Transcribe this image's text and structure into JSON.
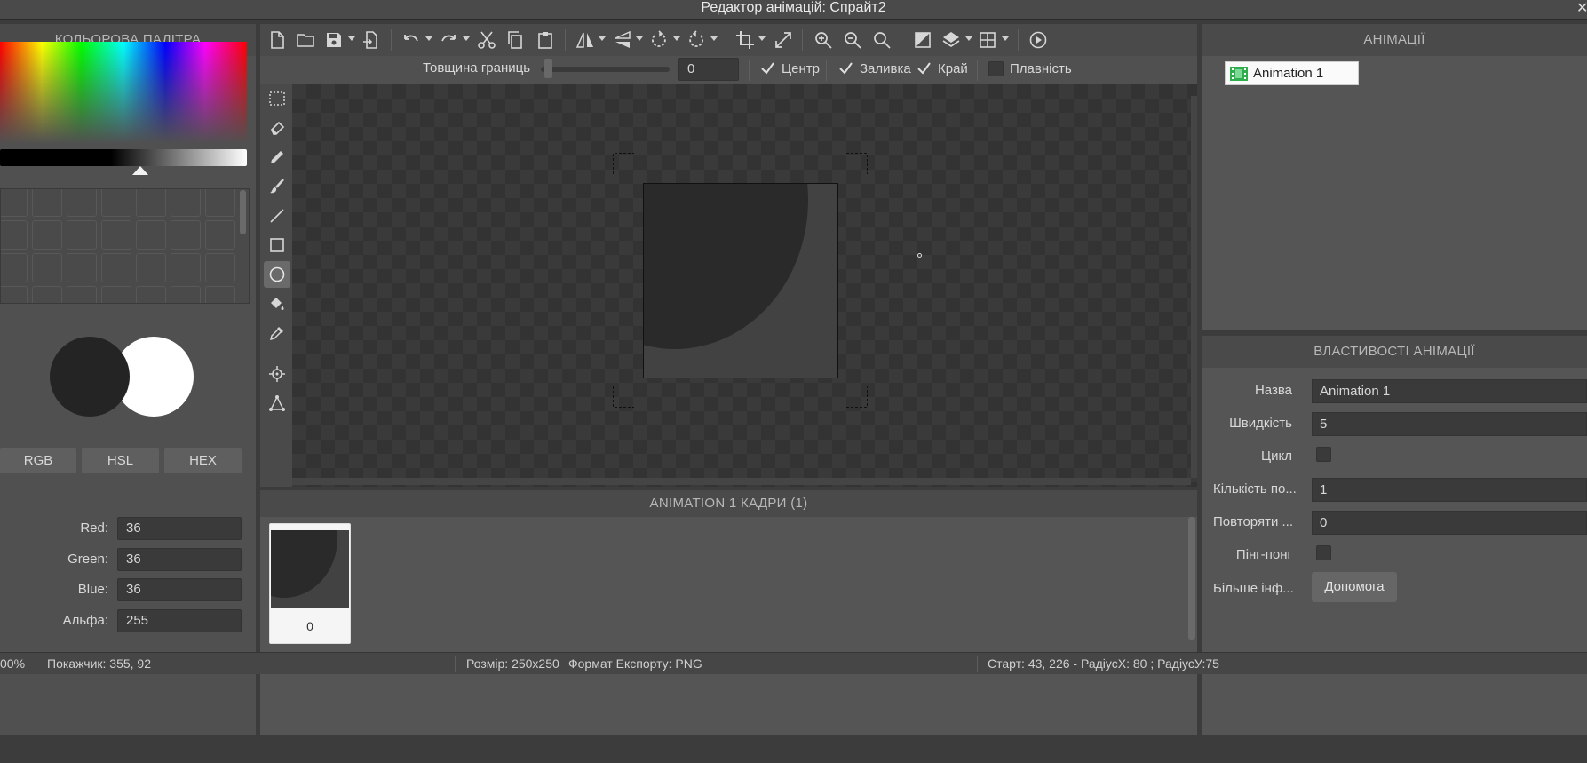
{
  "window": {
    "title": "Редактор анімацій: Спрайт2",
    "close_glyph": "✕"
  },
  "left_panel": {
    "header": "КОЛЬОРОВА ПАЛІТРА",
    "mode_buttons": [
      "RGB",
      "HSL",
      "HEX"
    ],
    "primary_color": "#242424",
    "secondary_color": "#ffffff",
    "fields": [
      {
        "label": "Red:",
        "value": "36"
      },
      {
        "label": "Green:",
        "value": "36"
      },
      {
        "label": "Blue:",
        "value": "36"
      },
      {
        "label": "Альфа:",
        "value": "255"
      }
    ]
  },
  "toolbar": {
    "icons": [
      "new-file-icon",
      "open-folder-icon",
      "save-icon",
      "export-icon",
      "undo-icon",
      "redo-icon",
      "cut-icon",
      "copy-icon",
      "paste-icon",
      "flip-horizontal-icon",
      "flip-vertical-icon",
      "rotate-left-icon",
      "rotate-right-icon",
      "crop-icon",
      "resize-icon",
      "zoom-in-icon",
      "zoom-out-icon",
      "zoom-reset-icon",
      "mask-icon",
      "layers-icon",
      "grid-icon",
      "play-icon"
    ]
  },
  "options": {
    "border_label": "Товщина границь",
    "border_value": "0",
    "center_label": "Центр",
    "fill_label": "Заливка",
    "edge_label": "Край",
    "smooth_label": "Плавність"
  },
  "frames_panel": {
    "header": "ANIMATION 1 КАДРИ (1)",
    "frames": [
      {
        "index": "0"
      }
    ]
  },
  "animations_panel": {
    "header": "АНІМАЦІЇ",
    "items": [
      {
        "label": "Animation 1"
      }
    ]
  },
  "properties": {
    "header": "ВЛАСТИВОСТІ АНІМАЦІЇ",
    "name_label": "Назва",
    "name_value": "Animation 1",
    "speed_label": "Швидкість",
    "speed_value": "5",
    "loop_label": "Цикл",
    "count_label": "Кількість по...",
    "count_value": "1",
    "repeat_label": "Повторяти ...",
    "repeat_value": "0",
    "pingpong_label": "Пінг-понг",
    "more_label": "Більше інф...",
    "help_label": "Допомога"
  },
  "status": {
    "zoom": "00%",
    "pointer": "Покажчик: 355, 92",
    "size": "Розмір: 250x250",
    "format": "Формат Експорту: PNG",
    "shape_info": "Старт: 43, 226 - РадіусХ: 80 ; РадіусУ:75"
  }
}
